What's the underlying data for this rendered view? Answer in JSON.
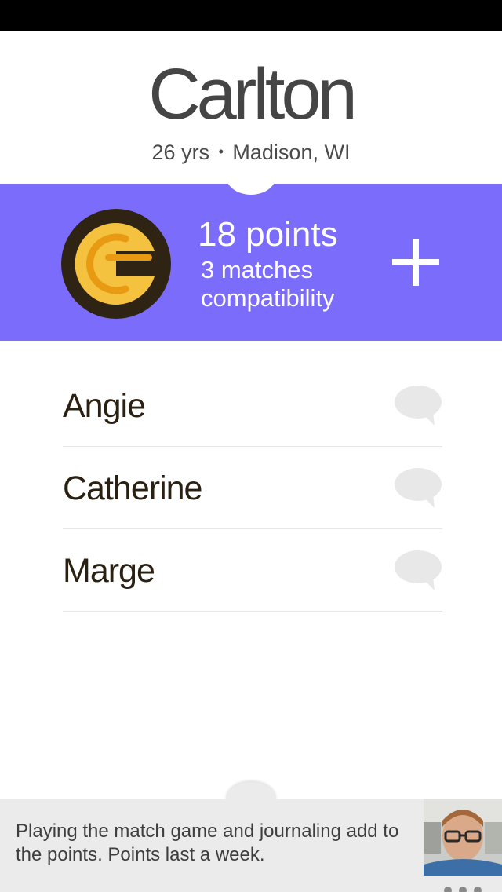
{
  "profile": {
    "name": "Carlton",
    "age": "26 yrs",
    "separator": "•",
    "location": "Madison, WI"
  },
  "score": {
    "points_label": "18 points",
    "matches_label": "3 matches",
    "compatibility_label": "compatibility",
    "add_icon": "plus-icon",
    "logo_icon": "coin-logo",
    "panel_color": "#7c6cfc",
    "coin_color": "#f4c23e",
    "coin_ring_color": "#2f2413"
  },
  "matches": [
    {
      "name": "Angie",
      "icon": "chat-bubble-icon"
    },
    {
      "name": "Catherine",
      "icon": "chat-bubble-icon"
    },
    {
      "name": "Marge",
      "icon": "chat-bubble-icon"
    }
  ],
  "tip": {
    "text": "Playing the match game and journaling add to the points. Points last a week."
  }
}
